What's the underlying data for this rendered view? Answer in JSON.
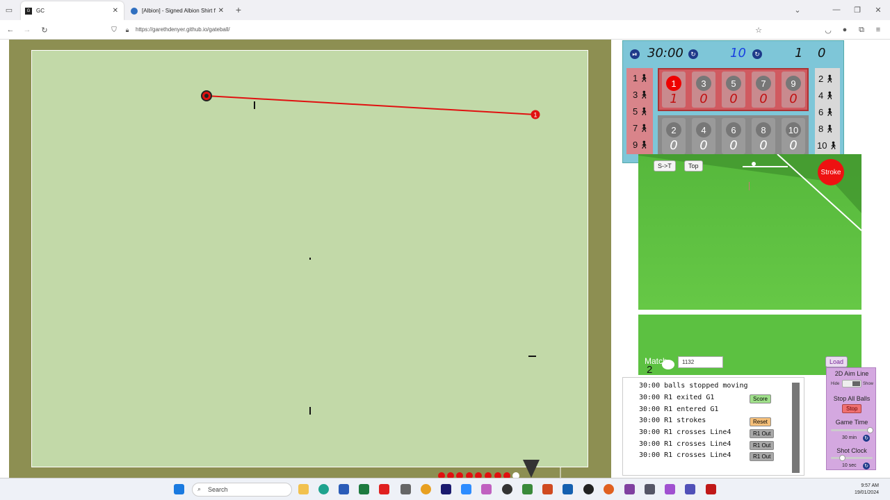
{
  "browser": {
    "tabs": [
      {
        "title": "GC"
      },
      {
        "title": "[Albion] - Signed Albion Shirt f"
      }
    ],
    "url": "https://garethdenyer.github.io/gateball/"
  },
  "scoreboard": {
    "game_time": "30:00",
    "shot_clock": "10",
    "team_score_red": "1",
    "team_score_white": "0",
    "red_players": [
      "1",
      "3",
      "5",
      "7",
      "9"
    ],
    "white_players": [
      "2",
      "4",
      "6",
      "8",
      "10"
    ],
    "red_cells": [
      {
        "num": "1",
        "score": "1"
      },
      {
        "num": "3",
        "score": "0"
      },
      {
        "num": "5",
        "score": "0"
      },
      {
        "num": "7",
        "score": "0"
      },
      {
        "num": "9",
        "score": "0"
      }
    ],
    "white_cells": [
      {
        "num": "2",
        "score": "0"
      },
      {
        "num": "4",
        "score": "0"
      },
      {
        "num": "6",
        "score": "0"
      },
      {
        "num": "8",
        "score": "0"
      },
      {
        "num": "10",
        "score": "0"
      }
    ]
  },
  "court": {
    "ball_label": "1"
  },
  "view3d": {
    "st_button": "S->T",
    "top_button": "Top",
    "stroke_button": "Stroke",
    "match_label": "Match",
    "match_number": "2",
    "seed_value": "1132",
    "load_button": "Load"
  },
  "log": [
    {
      "text": "30:00 balls stopped moving",
      "button": "",
      "btn_color": ""
    },
    {
      "text": "30:00 R1 exited G1",
      "button": "Score",
      "btn_color": "#9fe08a"
    },
    {
      "text": "30:00 R1 entered G1",
      "button": "",
      "btn_color": ""
    },
    {
      "text": "30:00 R1 strokes",
      "button": "Reset",
      "btn_color": "#f6c07a"
    },
    {
      "text": "30:00 R1 crosses Line4",
      "button": "R1 Out",
      "btn_color": "#a8a8a8"
    },
    {
      "text": "30:00 R1 crosses Line4",
      "button": "R1 Out",
      "btn_color": "#a8a8a8"
    },
    {
      "text": "30:00 R1 crosses Line4",
      "button": "R1 Out",
      "btn_color": "#a8a8a8"
    }
  ],
  "settings": {
    "aim_line_label": "2D Aim Line",
    "hide": "Hide",
    "show": "Show",
    "stop_all_label": "Stop All Balls",
    "stop_button": "Stop",
    "game_time_label": "Game Time",
    "game_time_value": "30 min",
    "shot_clock_label": "Shot Clock",
    "shot_clock_value": "10 sec"
  },
  "taskbar": {
    "search": "Search",
    "time": "9:57 AM",
    "date": "19/01/2024"
  },
  "colors": {
    "court": "#c2d9a8",
    "border": "#8d8f52",
    "red_ball": "#e01010",
    "scoreboard": "#7ec6d8"
  }
}
